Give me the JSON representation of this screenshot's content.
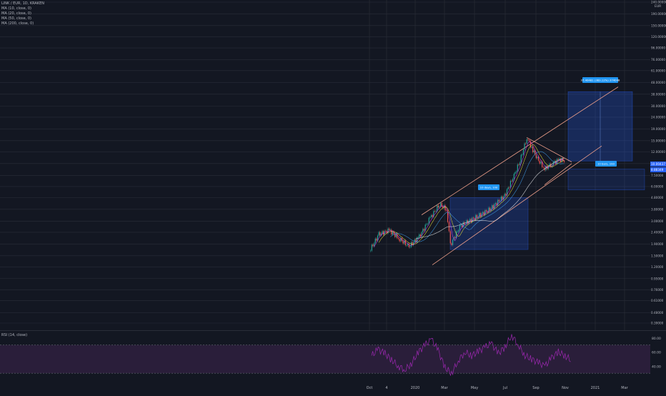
{
  "header": {
    "symbol_line": "LINK / EUR, 1D, KRAKEN",
    "indicators": [
      "MA (10, close, 0)",
      "MA (20, close, 0)",
      "MA (50, close, 0)",
      "MA (200, close, 0)"
    ],
    "currency": "EUR"
  },
  "rsi": {
    "legend": "RSI (14, close)",
    "ticks": [
      "80.00",
      "60.00",
      "40.00"
    ]
  },
  "colors": {
    "background": "#131722",
    "grid": "#2a2e39",
    "candle_up": "#26a69a",
    "candle_down": "#ef5350",
    "channel": "#f0a08a",
    "target_box": "#2962ff",
    "label_bg": "#2196f3",
    "rsi_line": "#9c27b0",
    "rsi_band": "#2a1e3a"
  },
  "chart_data": [
    {
      "type": "line",
      "title": "LINK / EUR, 1D, KRAKEN",
      "yscale": "log",
      "price_ticks": [
        "240.00000",
        "190.00000",
        "150.00000",
        "120.00000",
        "96.00000",
        "76.00000",
        "61.00000",
        "48.00000",
        "38.00000",
        "30.00000",
        "24.00000",
        "19.00000",
        "15.00000",
        "12.00000",
        "9.50000",
        "7.50000",
        "6.00000",
        "4.80000",
        "3.80000",
        "3.00000",
        "2.40000",
        "1.90000",
        "1.50000",
        "1.20000",
        "0.95000",
        "0.76000",
        "0.61000",
        "0.48000",
        "0.39000"
      ],
      "current_price_labels": [
        "10.00437",
        "8.88349"
      ],
      "time_ticks": [
        "Oct",
        "4",
        "2020",
        "Mar",
        "May",
        "Jul",
        "Sep",
        "Nov",
        "2021",
        "Mar"
      ],
      "price_series": [
        {
          "x": "2019-10-01",
          "close": 1.65
        },
        {
          "x": "2019-10-20",
          "close": 2.3
        },
        {
          "x": "2019-11-10",
          "close": 2.5
        },
        {
          "x": "2019-12-01",
          "close": 2.1
        },
        {
          "x": "2019-12-20",
          "close": 1.8
        },
        {
          "x": "2020-01-10",
          "close": 2.2
        },
        {
          "x": "2020-02-01",
          "close": 3.2
        },
        {
          "x": "2020-02-20",
          "close": 4.2
        },
        {
          "x": "2020-03-05",
          "close": 3.8
        },
        {
          "x": "2020-03-13",
          "close": 1.85
        },
        {
          "x": "2020-04-01",
          "close": 2.7
        },
        {
          "x": "2020-05-01",
          "close": 3.2
        },
        {
          "x": "2020-06-01",
          "close": 3.8
        },
        {
          "x": "2020-07-01",
          "close": 5.0
        },
        {
          "x": "2020-07-20",
          "close": 7.5
        },
        {
          "x": "2020-08-01",
          "close": 10.0
        },
        {
          "x": "2020-08-15",
          "close": 16.0
        },
        {
          "x": "2020-08-25",
          "close": 13.0
        },
        {
          "x": "2020-09-05",
          "close": 10.5
        },
        {
          "x": "2020-09-20",
          "close": 8.5
        },
        {
          "x": "2020-10-05",
          "close": 9.5
        },
        {
          "x": "2020-10-20",
          "close": 10.3
        },
        {
          "x": "2020-11-01",
          "close": 10.0
        }
      ],
      "annotations": [
        "10 days, 10d",
        "10 bars, 10d",
        "37.40481 (383.12%) 374048"
      ]
    },
    {
      "type": "line",
      "title": "RSI (14, close)",
      "ylim": [
        20,
        90
      ],
      "bands": [
        30,
        70
      ],
      "series": [
        {
          "values": [
            55,
            64,
            58,
            49,
            40,
            35,
            44,
            60,
            70,
            78,
            62,
            38,
            30,
            48,
            60,
            55,
            61,
            67,
            72,
            58,
            67,
            84,
            70,
            55,
            50,
            45,
            40,
            52,
            60,
            55,
            48
          ]
        }
      ]
    }
  ]
}
